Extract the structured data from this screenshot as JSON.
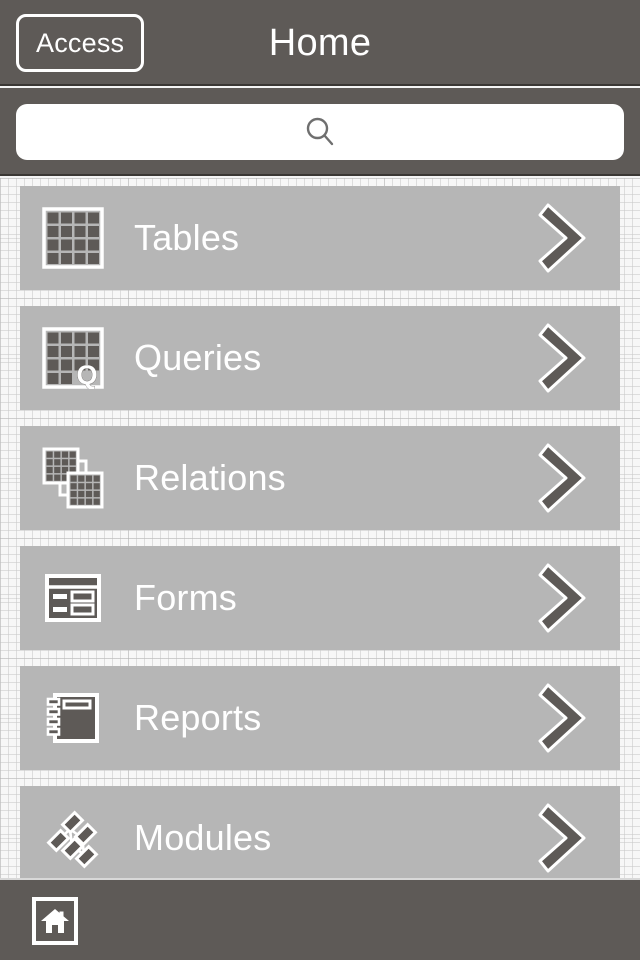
{
  "navbar": {
    "back_label": "Access",
    "title": "Home"
  },
  "search": {
    "value": "",
    "placeholder": "",
    "icon": "search-icon"
  },
  "list": {
    "items": [
      {
        "label": "Tables",
        "icon": "table-grid-icon",
        "chevron": "chevron-right-icon"
      },
      {
        "label": "Queries",
        "icon": "table-grid-q-icon",
        "chevron": "chevron-right-icon"
      },
      {
        "label": "Relations",
        "icon": "linked-grids-icon",
        "chevron": "chevron-right-icon"
      },
      {
        "label": "Forms",
        "icon": "form-window-icon",
        "chevron": "chevron-right-icon"
      },
      {
        "label": "Reports",
        "icon": "bound-notebook-icon",
        "chevron": "chevron-right-icon"
      },
      {
        "label": "Modules",
        "icon": "node-network-icon",
        "chevron": "chevron-right-icon"
      }
    ]
  },
  "toolbar": {
    "home_icon": "home-icon"
  },
  "colors": {
    "chrome": "#5e5a57",
    "row": "#b6b6b6",
    "row_text": "#ffffff",
    "icon_fill": "#5e5a57",
    "icon_outline": "#ffffff",
    "paper": "#f7f7f7"
  }
}
